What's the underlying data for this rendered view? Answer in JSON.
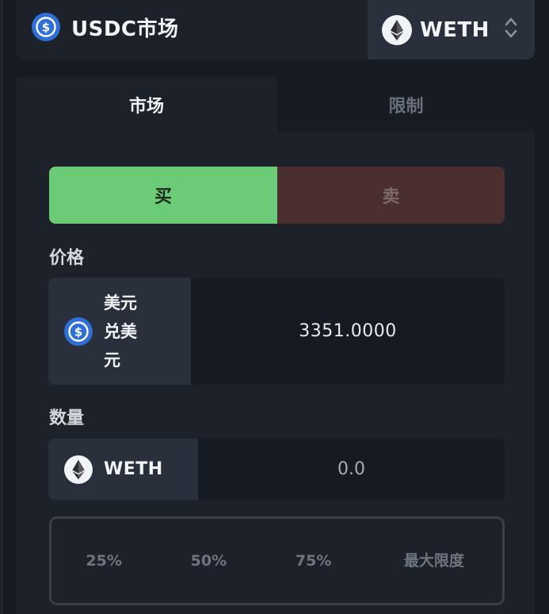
{
  "header": {
    "market_title": "USDC市场",
    "base_token": "WETH"
  },
  "tabs": {
    "market": "市场",
    "limit": "限制"
  },
  "side": {
    "buy": "买",
    "sell": "卖"
  },
  "price": {
    "label": "价格",
    "unit": "美元兑美元",
    "value": "3351.0000"
  },
  "quantity": {
    "label": "数量",
    "unit": "WETH",
    "value": "0.0"
  },
  "percent_buttons": [
    "25%",
    "50%",
    "75%",
    "最大限度"
  ],
  "colors": {
    "buy": "#6bcb77",
    "sell": "#4a2e30",
    "usdc": "#2f6fd6"
  }
}
